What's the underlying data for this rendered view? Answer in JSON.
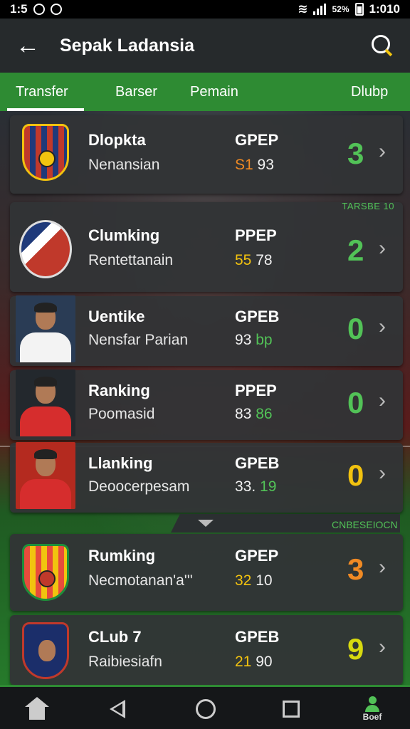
{
  "status_bar": {
    "time_left": "1:5",
    "time_right": "1:010",
    "battery_text": "52%"
  },
  "app_bar": {
    "title": "Sepak Ladansia",
    "back_icon": "arrow-left-icon",
    "search_icon": "search-icon"
  },
  "tabs": [
    {
      "label": "Transfer",
      "active": true
    },
    {
      "label": "Barser"
    },
    {
      "label": "Pemain"
    },
    {
      "label": "Dlubp"
    }
  ],
  "items": [
    {
      "name": "Dlopkta",
      "sub": "Nenansian",
      "code": "GPEP",
      "stat_a": "S1",
      "stat_b": "93",
      "big": "3",
      "thumb": "crest-red-stripes",
      "tag": ""
    },
    {
      "name": "Clumking",
      "sub": "Rentettanain",
      "code": "PPEP",
      "stat_a": "55",
      "stat_b": "78",
      "big": "2",
      "thumb": "shield-white",
      "tag": "TARSBE 10"
    },
    {
      "name": "Uentike",
      "sub": "Nensfar Parian",
      "code": "GPEB",
      "stat_a": "93",
      "stat_b": "bp",
      "big": "0",
      "thumb": "player-white",
      "tag": ""
    },
    {
      "name": "Ranking",
      "sub": "Poomasid",
      "code": "PPEP",
      "stat_a": "83",
      "stat_b": "86",
      "big": "0",
      "thumb": "player-red",
      "tag": ""
    },
    {
      "name": "Llanking",
      "sub": "Deoocerpesam",
      "code": "GPEB",
      "stat_a": "33.",
      "stat_b": "19",
      "big": "0",
      "thumb": "player-red-2",
      "tag": ""
    },
    {
      "name": "Rumking",
      "sub": "Necmotanan'a'''",
      "code": "GPEP",
      "stat_a": "32",
      "stat_b": "10",
      "big": "3",
      "thumb": "crest-yellow-red",
      "tag": ""
    },
    {
      "name": "CLub 7",
      "sub": "Raibiesiafn",
      "code": "GPEB",
      "stat_a": "21",
      "stat_b": "90",
      "big": "9",
      "thumb": "crest-navy",
      "tag": ""
    }
  ],
  "section_divider": {
    "label": "CNBESEIOCN",
    "icon": "caret-down-icon"
  },
  "bottom_nav": {
    "home_icon": "home-icon",
    "back_icon": "triangle-back-icon",
    "circle_icon": "circle-home-icon",
    "square_icon": "recent-apps-icon",
    "profile_label": "Boef"
  },
  "colors": {
    "accent": "#2e8b33",
    "green": "#52c257",
    "yellow": "#f2c20f",
    "orange": "#f08a24"
  }
}
